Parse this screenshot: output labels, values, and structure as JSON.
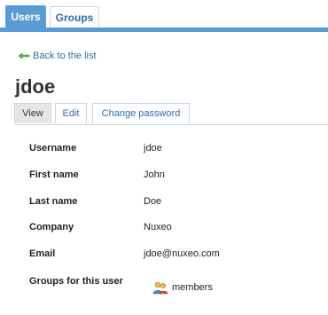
{
  "tabs": {
    "users": "Users",
    "groups": "Groups"
  },
  "back_link": "Back to the list",
  "user": {
    "title": "jdoe"
  },
  "subtabs": {
    "view": "View",
    "edit": "Edit",
    "change_password": "Change password"
  },
  "fields": [
    {
      "label": "Username",
      "value": "jdoe"
    },
    {
      "label": "First name",
      "value": "John"
    },
    {
      "label": "Last name",
      "value": "Doe"
    },
    {
      "label": "Company",
      "value": "Nuxeo"
    },
    {
      "label": "Email",
      "value": "jdoe@nuxeo.com"
    }
  ],
  "groups_label": "Groups for this user",
  "groups": [
    {
      "name": "members",
      "icon": "group-icon"
    }
  ],
  "icons": {
    "back": "back-arrow-icon",
    "group": "group-icon"
  },
  "colors": {
    "accent": "#5b9bd5",
    "link": "#2d6ca8"
  }
}
